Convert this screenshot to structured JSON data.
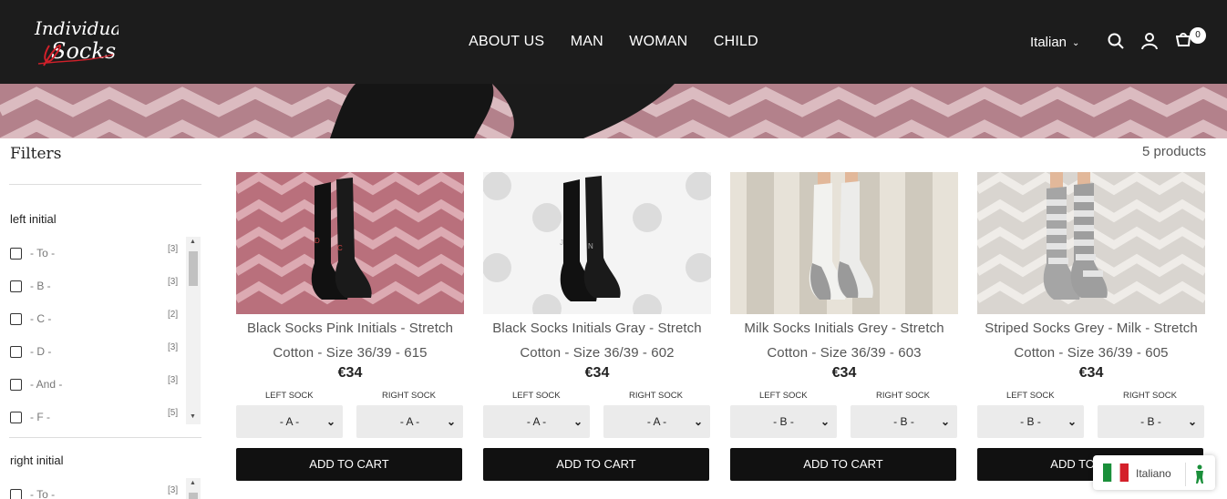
{
  "header": {
    "logo_alt": "Individual Socks",
    "nav": [
      "ABOUT US",
      "MAN",
      "WOMAN",
      "CHILD"
    ],
    "language": "Italian",
    "cart_count": "0",
    "icons": [
      "search-icon",
      "account-icon",
      "cart-icon"
    ]
  },
  "filters": {
    "title": "Filters",
    "left_initial": {
      "heading": "left initial",
      "items": [
        {
          "label": "- To -",
          "count": "[3]"
        },
        {
          "label": "- B -",
          "count": "[3]"
        },
        {
          "label": "- C -",
          "count": "[2]"
        },
        {
          "label": "- D -",
          "count": "[3]"
        },
        {
          "label": "- And -",
          "count": "[3]"
        },
        {
          "label": "- F -",
          "count": "[5]"
        }
      ]
    },
    "right_initial": {
      "heading": "right initial",
      "items": [
        {
          "label": "- To -",
          "count": "[3]"
        }
      ]
    }
  },
  "product_count": "5 products",
  "products": [
    {
      "title_line1": "Black Socks Pink Initials - Stretch",
      "title_line2": "Cotton - Size 36/39 - 615",
      "price": "€34",
      "left_label": "LEFT SOCK",
      "right_label": "RIGHT SOCK",
      "left_value": "- A -",
      "right_value": "- A -",
      "cta": "ADD TO CART"
    },
    {
      "title_line1": "Black Socks Initials Gray - Stretch",
      "title_line2": "Cotton - Size 36/39 - 602",
      "price": "€34",
      "left_label": "LEFT SOCK",
      "right_label": "RIGHT SOCK",
      "left_value": "- A -",
      "right_value": "- A -",
      "cta": "ADD TO CART"
    },
    {
      "title_line1": "Milk Socks Initials Grey - Stretch",
      "title_line2": "Cotton - Size 36/39 - 603",
      "price": "€34",
      "left_label": "LEFT SOCK",
      "right_label": "RIGHT SOCK",
      "left_value": "- B -",
      "right_value": "- B -",
      "cta": "ADD TO CART"
    },
    {
      "title_line1": "Striped Socks Grey - Milk - Stretch",
      "title_line2": "Cotton - Size 36/39 - 605",
      "price": "€34",
      "left_label": "LEFT SOCK",
      "right_label": "RIGHT SOCK",
      "left_value": "- B -",
      "right_value": "- B -",
      "cta": "ADD TO CART"
    }
  ],
  "language_widget": {
    "label": "Italiano"
  },
  "colors": {
    "header_bg": "#1c1c1c",
    "button_bg": "#111111",
    "select_bg": "#ebebeb",
    "banner_pink": "#b87c87"
  }
}
